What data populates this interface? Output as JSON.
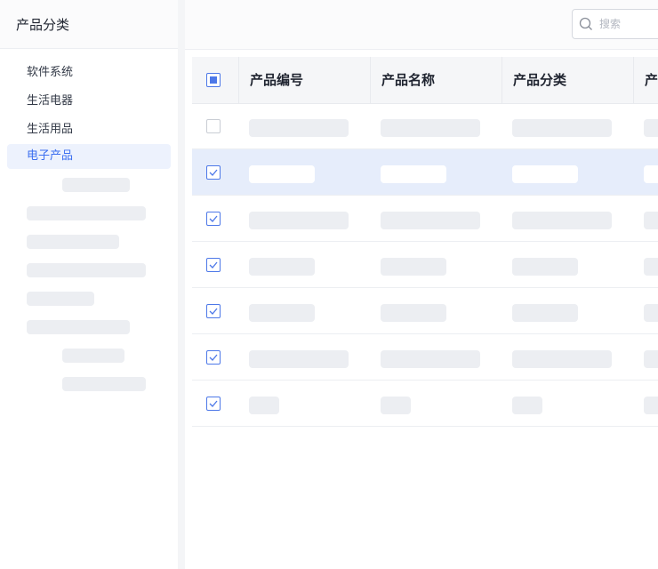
{
  "sidebar": {
    "title": "产品分类",
    "items": [
      {
        "label": "软件系统",
        "active": false
      },
      {
        "label": "生活电器",
        "active": false
      },
      {
        "label": "生活用品",
        "active": false
      },
      {
        "label": "电子产品",
        "active": true
      }
    ]
  },
  "search": {
    "placeholder": "搜索",
    "icon": "search-icon"
  },
  "table": {
    "columns": [
      "产品编号",
      "产品名称",
      "产品分类",
      "产"
    ],
    "header_checkbox": "partial",
    "rows": [
      {
        "checked": false,
        "selected": false
      },
      {
        "checked": true,
        "selected": true
      },
      {
        "checked": true,
        "selected": false
      },
      {
        "checked": true,
        "selected": false
      },
      {
        "checked": true,
        "selected": false
      },
      {
        "checked": true,
        "selected": false
      },
      {
        "checked": true,
        "selected": false
      }
    ]
  },
  "colors": {
    "accent": "#3c6ff0",
    "selected_row": "#e6edfb",
    "skeleton": "#eceef2"
  }
}
